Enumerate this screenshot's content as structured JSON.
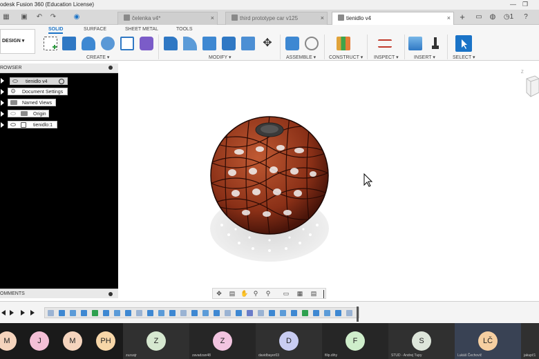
{
  "window": {
    "title": "odesk Fusion 360 (Education License)",
    "minimize_glyph": "—",
    "restore_glyph": "❐"
  },
  "tabs": [
    {
      "label": "čelenka v4*",
      "icon": "component-icon"
    },
    {
      "label": "third prototype car v125",
      "icon": "component-icon"
    },
    {
      "label": "tienidlo v4",
      "icon": "component-icon"
    }
  ],
  "tab_close_glyph": "×",
  "header_right": {
    "new_tab_glyph": "+",
    "notification_count": "1"
  },
  "ribbon": {
    "workspace": "DESIGN",
    "workspace_arrow": "▾",
    "tabs": [
      "SOLID",
      "SURFACE",
      "SHEET METAL",
      "TOOLS"
    ],
    "groups": [
      "CREATE ▾",
      "MODIFY ▾",
      "ASSEMBLE ▾",
      "CONSTRUCT ▾",
      "INSPECT ▾",
      "INSERT ▾",
      "SELECT ▾"
    ]
  },
  "browser": {
    "header": "ROWSER",
    "nodes": [
      {
        "label": "tienidlo v4"
      },
      {
        "label": "Document Settings"
      },
      {
        "label": "Named Views"
      },
      {
        "label": "Origin"
      },
      {
        "label": "tienidlo:1"
      }
    ]
  },
  "comments": {
    "header": "OMMENTS"
  },
  "participants": [
    {
      "initials": "M",
      "name": "",
      "color": "#f5d4bd"
    },
    {
      "initials": "J",
      "name": "",
      "color": "#f4bfd6"
    },
    {
      "initials": "M",
      "name": "",
      "color": "#f5d4bd"
    },
    {
      "initials": "PH",
      "name": "",
      "color": "#f7d6a8"
    },
    {
      "initials": "Z",
      "name": "zuzusjr",
      "color": "#d6e8d0"
    },
    {
      "initials": "Z",
      "name": "zavadzan48",
      "color": "#f2c4e0"
    },
    {
      "initials": "D",
      "name": "davidbayer03",
      "color": "#c9cdf2"
    },
    {
      "initials": "F",
      "name": "filip.dihy",
      "color": "#cfeecb"
    },
    {
      "initials": "S",
      "name": "STUD - Andrej Tupy",
      "color": "#dde5da"
    },
    {
      "initials": "LČ",
      "name": "Lukáš Čechovič",
      "color": "#f6cfa1"
    },
    {
      "initials": "",
      "name": "jakupč1",
      "color": "#303030"
    }
  ],
  "colors": {
    "accent": "#1a73c7",
    "lamp_fill": "#9b3b1f",
    "lamp_dark": "#5a1d0d"
  }
}
